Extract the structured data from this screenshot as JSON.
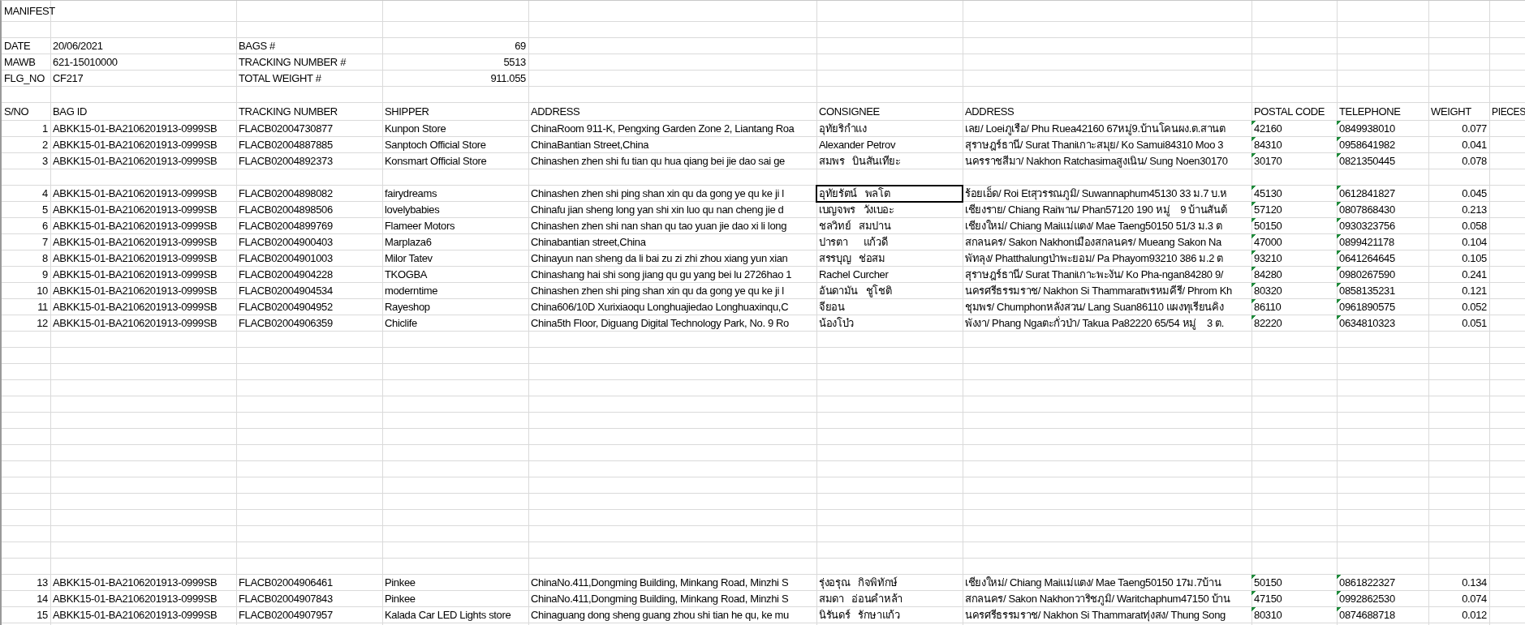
{
  "sheet": {
    "title": "MANIFEST",
    "details": [
      {
        "label": "DATE",
        "value": "20/06/2021",
        "label_2": "BAGS #",
        "value_2": "69"
      },
      {
        "label": "MAWB",
        "value": "621-15010000",
        "label_2": "TRACKING NUMBER #",
        "value_2": "5513"
      },
      {
        "label": "FLG_NO",
        "value": "CF217",
        "label_2": "TOTAL WEIGHT #",
        "value_2": "911.055"
      }
    ],
    "columns": [
      "S/NO",
      "BAG ID",
      "TRACKING NUMBER",
      "SHIPPER",
      "ADDRESS",
      "CONSIGNEE",
      "ADDRESS",
      "POSTAL CODE",
      "TELEPHONE",
      "WEIGHT",
      "PIECES"
    ],
    "upper_rows": [
      {
        "kind": "entry",
        "sno": "1",
        "bag_id": "ABKK15-01-BA2106201913-0999SB",
        "tracking_number": "FLACB02004730877",
        "shipper": "Kunpon Store",
        "address": "ChinaRoom 911-K, Pengxing Garden Zone 2, Liantang Roa",
        "consignee": "อุทัยริกำแง",
        "consignee_selected": false,
        "address_2": "เลย/ Loeiภูเรือ/ Phu Ruea42160 67หมู่9.บ้านโคนผง.ต.สานต",
        "postal_code": "42160",
        "telephone": "0849938010",
        "weight": "0.077",
        "number_as_text": true
      },
      {
        "kind": "entry",
        "sno": "2",
        "bag_id": "ABKK15-01-BA2106201913-0999SB",
        "tracking_number": "FLACB02004887885",
        "shipper": "Sanptoch Official Store",
        "address": "ChinaBantian Street,China",
        "consignee": "Alexander Petrov",
        "consignee_selected": false,
        "address_2": "สุราษฎร์ธานี/ Surat Thaniเกาะสมุย/ Ko Samui84310 Moo 3",
        "postal_code": "84310",
        "telephone": "0958641982",
        "weight": "0.041",
        "number_as_text": true
      },
      {
        "kind": "entry",
        "sno": "3",
        "bag_id": "ABKK15-01-BA2106201913-0999SB",
        "tracking_number": "FLACB02004892373",
        "shipper": "Konsmart Official Store",
        "address": "Chinashen zhen shi fu tian qu hua qiang bei jie dao sai ge",
        "consignee": "สมพร   บินสันเทียะ",
        "consignee_selected": false,
        "address_2": "นครราชสีมา/ Nakhon Ratchasimaสูงเนิน/ Sung Noen30170",
        "postal_code": "30170",
        "telephone": "0821350445",
        "weight": "0.078",
        "number_as_text": true
      },
      {
        "kind": "spacer"
      },
      {
        "kind": "entry",
        "sno": "4",
        "bag_id": "ABKK15-01-BA2106201913-0999SB",
        "tracking_number": "FLACB02004898082",
        "shipper": "fairydreams",
        "address": "Chinashen zhen shi ping shan xin qu da gong ye qu ke ji l",
        "consignee": "อุทัยรัตน์   พลโต",
        "consignee_selected": true,
        "address_2": "ร้อยเอ็ด/ Roi Etสุวรรณภูมิ/ Suwannaphum45130 33 ม.7 บ.ห",
        "postal_code": "45130",
        "telephone": "0612841827",
        "weight": "0.045",
        "number_as_text": true
      },
      {
        "kind": "entry",
        "sno": "5",
        "bag_id": "ABKK15-01-BA2106201913-0999SB",
        "tracking_number": "FLACB02004898506",
        "shipper": "lovelybabies",
        "address": "Chinafu jian sheng long yan shi xin luo qu nan cheng jie d",
        "consignee": "เบญจพร   วังเบอะ",
        "consignee_selected": false,
        "address_2": "เชียงราย/ Chiang Raiพาน/ Phan57120 190 หมู่    9 บ้านสันต้",
        "postal_code": "57120",
        "telephone": "0807868430",
        "weight": "0.213",
        "number_as_text": true
      },
      {
        "kind": "entry",
        "sno": "6",
        "bag_id": "ABKK15-01-BA2106201913-0999SB",
        "tracking_number": "FLACB02004899769",
        "shipper": "Flameer Motors",
        "address": "Chinashen zhen shi nan shan qu tao yuan jie dao xi li long",
        "consignee": "ชลวิทย์   สมปาน",
        "consignee_selected": false,
        "address_2": "เชียงใหม่/ Chiang Maiแม่แตง/ Mae Taeng50150 51/3 ม.3 ต",
        "postal_code": "50150",
        "telephone": "0930323756",
        "weight": "0.058",
        "number_as_text": true
      },
      {
        "kind": "entry",
        "sno": "7",
        "bag_id": "ABKK15-01-BA2106201913-0999SB",
        "tracking_number": "FLACB02004900403",
        "shipper": "Marplaza6",
        "address": "Chinabantian street,China",
        "consignee": "ปารตา      แก้วดี",
        "consignee_selected": false,
        "address_2": "สกลนคร/ Sakon Nakhonเมืองสกลนคร/ Mueang Sakon Na",
        "postal_code": "47000",
        "telephone": "0899421178",
        "weight": "0.104",
        "number_as_text": true
      },
      {
        "kind": "entry",
        "sno": "8",
        "bag_id": "ABKK15-01-BA2106201913-0999SB",
        "tracking_number": "FLACB02004901003",
        "shipper": "Milor Tatev",
        "address": "Chinayun nan sheng da li bai zu zi zhi zhou xiang yun xian",
        "consignee": "สรรบุญ   ช่อสม",
        "consignee_selected": false,
        "address_2": "พัทลุง/ Phatthalungป่าพะยอม/ Pa Phayom93210 386 ม.2 ต",
        "postal_code": "93210",
        "telephone": "0641264645",
        "weight": "0.105",
        "number_as_text": true
      },
      {
        "kind": "entry",
        "sno": "9",
        "bag_id": "ABKK15-01-BA2106201913-0999SB",
        "tracking_number": "FLACB02004904228",
        "shipper": "TKOGBA",
        "address": "Chinashang hai shi song jiang qu gu yang bei lu 2726hao 1",
        "consignee": "Rachel Curcher",
        "consignee_selected": false,
        "address_2": "สุราษฎร์ธานี/ Surat Thaniเกาะพะงัน/ Ko Pha-ngan84280 9/",
        "postal_code": "84280",
        "telephone": "0980267590",
        "weight": "0.241",
        "number_as_text": true
      },
      {
        "kind": "entry",
        "sno": "10",
        "bag_id": "ABKK15-01-BA2106201913-0999SB",
        "tracking_number": "FLACB02004904534",
        "shipper": "moderntime",
        "address": "Chinashen zhen shi ping shan xin qu da gong ye qu ke ji l",
        "consignee": "อันดามัน   ชูโชติ",
        "consignee_selected": false,
        "address_2": "นครศรีธรรมราช/ Nakhon Si Thammaratพรหมคีรี/ Phrom Kh",
        "postal_code": "80320",
        "telephone": "0858135231",
        "weight": "0.121",
        "number_as_text": true
      },
      {
        "kind": "entry",
        "sno": "11",
        "bag_id": "ABKK15-01-BA2106201913-0999SB",
        "tracking_number": "FLACB02004904952",
        "shipper": "Rayeshop",
        "address": "China606/10D Xurixiaoqu Longhuajiedao Longhuaxinqu,C",
        "consignee": "จียอน",
        "consignee_selected": false,
        "address_2": "ชุมพร/ Chumphonหลังสวน/ Lang Suan86110 แผงทุเรียนคิง",
        "postal_code": "86110",
        "telephone": "0961890575",
        "weight": "0.052",
        "number_as_text": true
      },
      {
        "kind": "entry",
        "sno": "12",
        "bag_id": "ABKK15-01-BA2106201913-0999SB",
        "tracking_number": "FLACB02004906359",
        "shipper": "Chiclife",
        "address": "China5th Floor, Diguang Digital Technology Park, No. 9 Ro",
        "consignee": "น้องโบ๋ว",
        "consignee_selected": false,
        "address_2": "พังงา/ Phang Ngaตะกั่วป่า/ Takua Pa82220 65/54 หมู่    3 ต.",
        "postal_code": "82220",
        "telephone": "0634810323",
        "weight": "0.051",
        "number_as_text": true
      }
    ],
    "lower_rows": [
      {
        "kind": "entry",
        "sno": "13",
        "bag_id": "ABKK15-01-BA2106201913-0999SB",
        "tracking_number": "FLACB02004906461",
        "shipper": "Pinkee",
        "address": "ChinaNo.411,Dongming Building, Minkang Road, Minzhi S",
        "consignee": "รุ่งอรุณ   กิจพิทักษ์",
        "consignee_selected": false,
        "address_2": "เชียงใหม่/ Chiang Maiแม่แตง/ Mae Taeng50150 17ม.7บ้าน",
        "postal_code": "50150",
        "telephone": "0861822327",
        "weight": "0.134",
        "number_as_text": true
      },
      {
        "kind": "entry",
        "sno": "14",
        "bag_id": "ABKK15-01-BA2106201913-0999SB",
        "tracking_number": "FLACB02004907843",
        "shipper": "Pinkee",
        "address": "ChinaNo.411,Dongming Building, Minkang Road, Minzhi S",
        "consignee": "สมดา   อ่อนคำหล้า",
        "consignee_selected": false,
        "address_2": "สกลนคร/ Sakon Nakhonวาริชภูมิ/ Waritchaphum47150 บ้าน",
        "postal_code": "47150",
        "telephone": "0992862530",
        "weight": "0.074",
        "number_as_text": true
      },
      {
        "kind": "entry",
        "sno": "15",
        "bag_id": "ABKK15-01-BA2106201913-0999SB",
        "tracking_number": "FLACB02004907957",
        "shipper": "Kalada Car LED Lights store",
        "address": "Chinaguang dong sheng guang zhou shi tian he qu, ke mu",
        "consignee": "นิรันดร์   รักษาแก้ว",
        "consignee_selected": false,
        "address_2": "นครศรีธรรมราช/ Nakhon Si Thammaratทุ่งสง/ Thung Song",
        "postal_code": "80310",
        "telephone": "0874688718",
        "weight": "0.012",
        "number_as_text": true
      }
    ]
  }
}
